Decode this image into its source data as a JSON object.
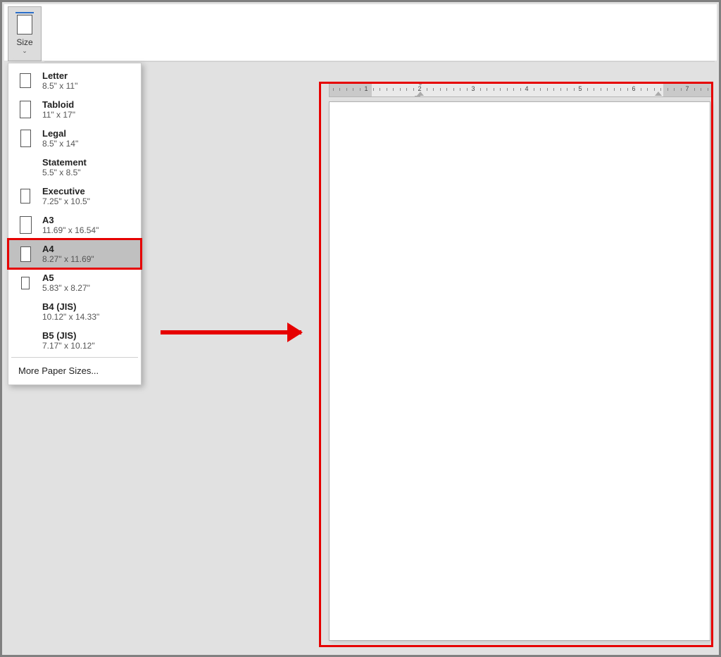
{
  "ribbon": {
    "size_button_label": "Size"
  },
  "size_menu": {
    "items": [
      {
        "name": "Letter",
        "dims": "8.5\" x 11\"",
        "thumb_w": 16,
        "thumb_h": 21,
        "show_thumb": true
      },
      {
        "name": "Tabloid",
        "dims": "11\" x 17\"",
        "thumb_w": 16,
        "thumb_h": 25,
        "show_thumb": true
      },
      {
        "name": "Legal",
        "dims": "8.5\" x 14\"",
        "thumb_w": 15,
        "thumb_h": 25,
        "show_thumb": true
      },
      {
        "name": "Statement",
        "dims": "5.5\" x 8.5\"",
        "thumb_w": 12,
        "thumb_h": 18,
        "show_thumb": false
      },
      {
        "name": "Executive",
        "dims": "7.25\" x 10.5\"",
        "thumb_w": 14,
        "thumb_h": 21,
        "show_thumb": true
      },
      {
        "name": "A3",
        "dims": "11.69\" x 16.54\"",
        "thumb_w": 17,
        "thumb_h": 25,
        "show_thumb": true
      },
      {
        "name": "A4",
        "dims": "8.27\" x 11.69\"",
        "thumb_w": 15,
        "thumb_h": 22,
        "show_thumb": true,
        "selected": true,
        "highlighted": true
      },
      {
        "name": "A5",
        "dims": "5.83\" x 8.27\"",
        "thumb_w": 12,
        "thumb_h": 18,
        "show_thumb": true
      },
      {
        "name": "B4 (JIS)",
        "dims": "10.12\" x 14.33\"",
        "thumb_w": 16,
        "thumb_h": 23,
        "show_thumb": false
      },
      {
        "name": "B5 (JIS)",
        "dims": "7.17\" x 10.12\"",
        "thumb_w": 14,
        "thumb_h": 20,
        "show_thumb": false
      }
    ],
    "more_label": "More Paper Sizes..."
  },
  "ruler": {
    "numbers": [
      1,
      2,
      3,
      4,
      5,
      6,
      7
    ]
  },
  "annotation": {
    "arrow_color": "#e60000",
    "highlight_color": "#e60000"
  }
}
